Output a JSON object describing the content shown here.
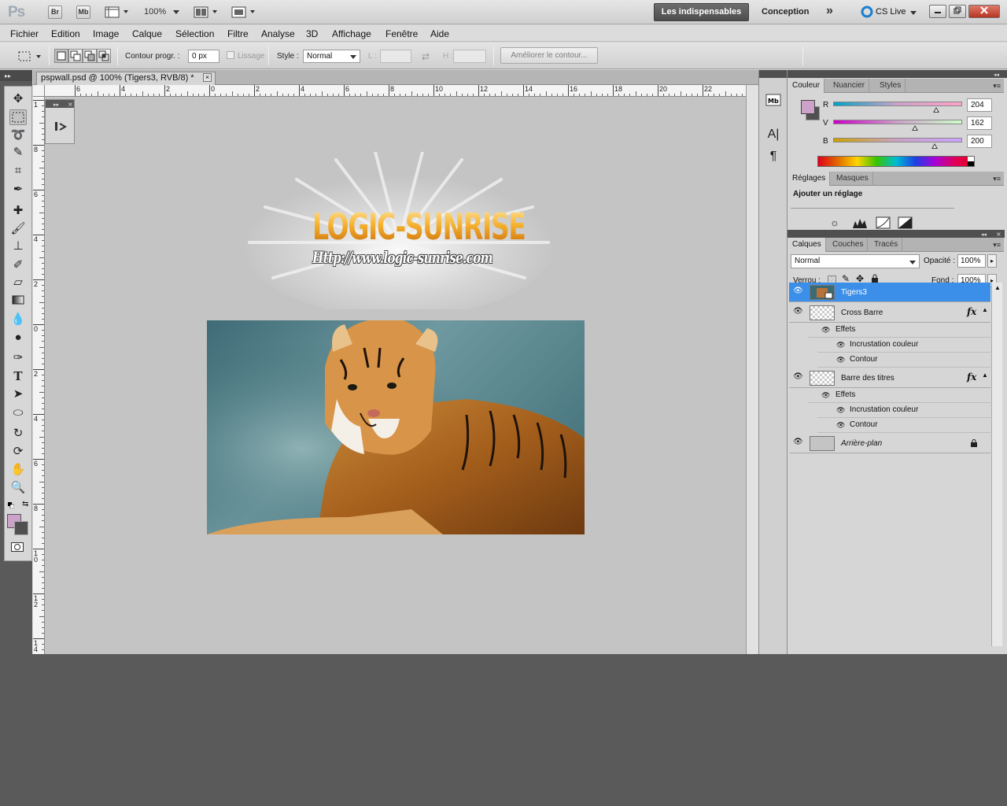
{
  "appbar": {
    "logo": "Ps",
    "bridge": "Br",
    "mini_bridge": "Mb",
    "zoom": "100%",
    "workspace_active": "Les indispensables",
    "workspace_other": "Conception",
    "more": "»",
    "cs_live": "CS Live"
  },
  "menu": [
    "Fichier",
    "Edition",
    "Image",
    "Calque",
    "Sélection",
    "Filtre",
    "Analyse",
    "3D",
    "Affichage",
    "Fenêtre",
    "Aide"
  ],
  "options": {
    "feather_label": "Contour progr. :",
    "feather_value": "0 px",
    "antialias_label": "Lissage",
    "style_label": "Style :",
    "style_value": "Normal",
    "width_label": "L :",
    "height_label": "H :",
    "refine_button": "Améliorer le contour..."
  },
  "document": {
    "tab_title": "pspwall.psd @ 100% (Tigers3, RVB/8) *",
    "close": "×",
    "ruler_h": [
      "6",
      "4",
      "2",
      "0",
      "2",
      "4",
      "6",
      "8",
      "10",
      "12",
      "14",
      "16",
      "18",
      "20",
      "22",
      "2"
    ],
    "ruler_v": [
      "1",
      "8",
      "6",
      "4",
      "2",
      "0",
      "2",
      "4",
      "6",
      "8",
      "10",
      "12",
      "14"
    ],
    "logo_title": "LOGIC-SUNRISE",
    "logo_url": "Http://www.logic-sunrise.com"
  },
  "color_panel": {
    "tabs": [
      "Couleur",
      "Nuancier",
      "Styles"
    ],
    "channels": [
      {
        "label": "R",
        "value": "204",
        "fraction": 0.8
      },
      {
        "label": "V",
        "value": "162",
        "fraction": 0.635
      },
      {
        "label": "B",
        "value": "200",
        "fraction": 0.784
      }
    ],
    "foreground": "#cca2c8",
    "background": "#505050"
  },
  "adjust_panel": {
    "tabs": [
      "Réglages",
      "Masques"
    ],
    "title": "Ajouter un réglage"
  },
  "layers_panel": {
    "tabs": [
      "Calques",
      "Couches",
      "Tracés"
    ],
    "blend_mode": "Normal",
    "opacity_label": "Opacité :",
    "opacity_value": "100%",
    "lock_label": "Verrou :",
    "fill_label": "Fond :",
    "fill_value": "100%",
    "layers": [
      {
        "name": "Tigers3",
        "selected": true
      },
      {
        "name": "Cross Barre",
        "fx": "fx",
        "effects_label": "Effets",
        "effects": [
          "Incrustation couleur",
          "Contour"
        ]
      },
      {
        "name": "Barre des titres",
        "fx": "fx",
        "effects_label": "Effets",
        "effects": [
          "Incrustation couleur",
          "Contour"
        ]
      },
      {
        "name": "Arrière-plan",
        "locked": true
      }
    ]
  }
}
